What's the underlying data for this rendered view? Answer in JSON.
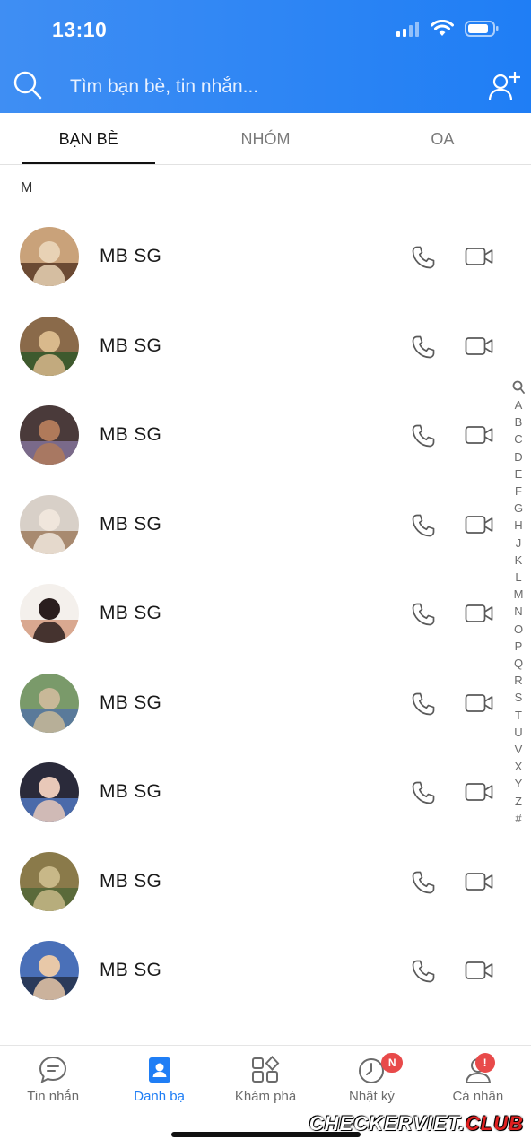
{
  "status_bar": {
    "time": "13:10"
  },
  "header": {
    "search_placeholder": "Tìm bạn bè, tin nhắn...",
    "icons": {
      "search": "search-icon",
      "add_friend": "add-friend-icon"
    }
  },
  "tabs": [
    {
      "label": "BẠN BÈ",
      "active": true
    },
    {
      "label": "NHÓM",
      "active": false
    },
    {
      "label": "OA",
      "active": false
    }
  ],
  "section_letter": "M",
  "contacts": [
    {
      "name": "MB SG"
    },
    {
      "name": "MB SG"
    },
    {
      "name": "MB SG"
    },
    {
      "name": "MB SG"
    },
    {
      "name": "MB SG"
    },
    {
      "name": "MB SG"
    },
    {
      "name": "MB SG"
    },
    {
      "name": "MB SG"
    },
    {
      "name": "MB SG"
    }
  ],
  "alphabet_index": [
    "A",
    "B",
    "C",
    "D",
    "E",
    "F",
    "G",
    "H",
    "J",
    "K",
    "L",
    "M",
    "N",
    "O",
    "P",
    "Q",
    "R",
    "S",
    "T",
    "U",
    "V",
    "X",
    "Y",
    "Z",
    "#"
  ],
  "bottom_nav": [
    {
      "label": "Tin nhắn",
      "icon": "chat-icon",
      "active": false,
      "badge": ""
    },
    {
      "label": "Danh bạ",
      "icon": "contacts-icon",
      "active": true,
      "badge": ""
    },
    {
      "label": "Khám phá",
      "icon": "grid-icon",
      "active": false,
      "badge": ""
    },
    {
      "label": "Nhật ký",
      "icon": "clock-icon",
      "active": false,
      "badge": "N"
    },
    {
      "label": "Cá nhân",
      "icon": "person-icon",
      "active": false,
      "badge": "!"
    }
  ],
  "watermark": {
    "main": "CHECKERVIET.",
    "accent": "CLUB"
  },
  "colors": {
    "brand": "#1f7ef5",
    "badge": "#e84a4a"
  }
}
